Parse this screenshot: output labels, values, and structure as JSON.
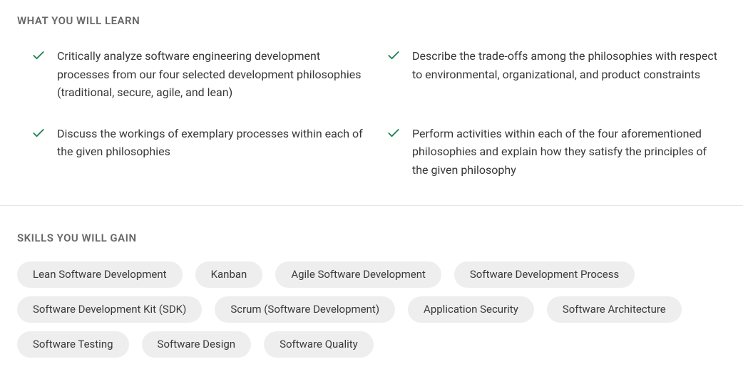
{
  "learn": {
    "heading": "WHAT YOU WILL LEARN",
    "items": [
      "Critically analyze software engineering development processes from our four selected development philosophies (traditional, secure, agile, and lean)",
      "Describe the trade-offs among the philosophies with respect to environmental, organizational, and product constraints",
      "Discuss the workings of exemplary processes within each of the given philosophies",
      "Perform activities within each of the four aforementioned philosophies and explain how they satisfy the principles of the given philosophy"
    ]
  },
  "skills": {
    "heading": "SKILLS YOU WILL GAIN",
    "items": [
      "Lean Software Development",
      "Kanban",
      "Agile Software Development",
      "Software Development Process",
      "Software Development Kit (SDK)",
      "Scrum (Software Development)",
      "Application Security",
      "Software Architecture",
      "Software Testing",
      "Software Design",
      "Software Quality"
    ]
  }
}
